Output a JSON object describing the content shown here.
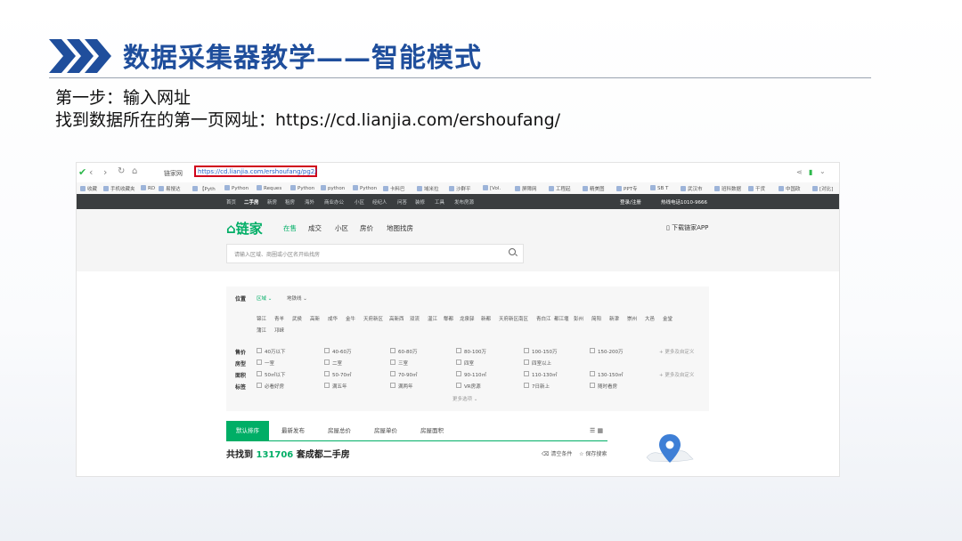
{
  "slide": {
    "title": "数据采集器教学——智能模式",
    "step": "第一步：输入网址",
    "instruction": "找到数据所在的第一页网址：https://cd.lianjia.com/ershoufang/",
    "accent_color": "#1f4e9c"
  },
  "browser": {
    "site_name": "链家网",
    "url": "https://cd.lianjia.com/ershoufang/pg2/",
    "highlight_color": "#d0021b",
    "bookmarks": [
      "收藏",
      "手机收藏夹",
      "RD",
      "易搜达",
      "【Pyth",
      "Python",
      "Reques",
      "Python",
      "python",
      "Python",
      "卡料巴",
      "域米拉",
      "沙群平",
      "[Vol.",
      "屏障网",
      "工程起",
      "精美图",
      "PPT专",
      "SB T",
      "武汉市",
      "班科数据",
      "干货",
      "中国政",
      "[对比]"
    ]
  },
  "site": {
    "topbar": [
      "首页",
      "二手房",
      "新房",
      "租房",
      "海外",
      "商业办公",
      "小区",
      "经纪人",
      "问答",
      "装修",
      "工具",
      "发布房源"
    ],
    "topbar_right": [
      "登录/注册",
      "热线电话1010-9666"
    ],
    "logo": "链家",
    "nav": [
      "在售",
      "成交",
      "小区",
      "房价",
      "地图找房"
    ],
    "app_link": "下载链家APP",
    "search_placeholder": "请输入区域、商圈或小区名开始找房",
    "filter": {
      "position_label": "位置",
      "position_tabs": [
        "区域",
        "地铁线"
      ],
      "districts_row1": [
        "锦江",
        "青羊",
        "武侯",
        "高新",
        "成华",
        "金牛",
        "天府新区",
        "高新西",
        "双流",
        "温江",
        "郫都",
        "龙泉驿",
        "新都",
        "天府新区南区",
        "青白江",
        "都江堰",
        "彭州",
        "简阳",
        "新津",
        "崇州",
        "大邑",
        "金堂"
      ],
      "districts_row2": [
        "蒲江",
        "邛崃"
      ],
      "rows": [
        {
          "label": "售价",
          "options": [
            "40万以下",
            "40-60万",
            "60-80万",
            "80-100万",
            "100-150万",
            "150-200万"
          ],
          "more": "更多及自定义"
        },
        {
          "label": "房型",
          "options": [
            "一室",
            "二室",
            "三室",
            "四室",
            "四室以上"
          ],
          "more": ""
        },
        {
          "label": "面积",
          "options": [
            "50㎡以下",
            "50-70㎡",
            "70-90㎡",
            "90-110㎡",
            "110-130㎡",
            "130-150㎡"
          ],
          "more": "更多及自定义"
        },
        {
          "label": "标签",
          "options": [
            "必看好房",
            "满五年",
            "满两年",
            "VR房源",
            "7日新上",
            "随时看房"
          ],
          "more": ""
        }
      ],
      "more_options": "更多选项"
    },
    "tabs": [
      "默认排序",
      "最新发布",
      "房屋总价",
      "房屋单价",
      "房屋面积"
    ],
    "result_prefix": "共找到",
    "result_count": "131706",
    "result_suffix": "套成都二手房",
    "clear_conditions": "清空条件",
    "save_search": "保存搜索"
  }
}
